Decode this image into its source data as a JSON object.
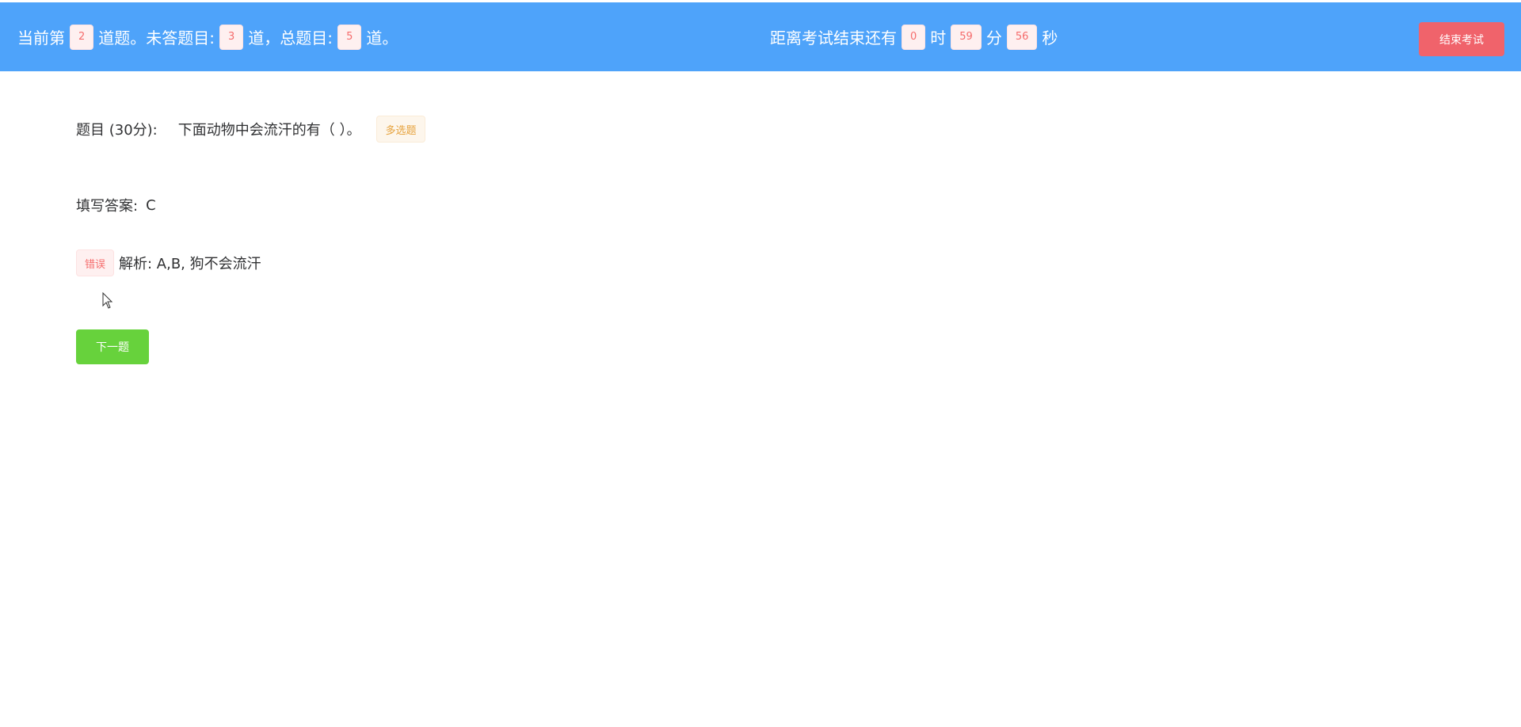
{
  "header": {
    "progress": {
      "prefix": "当前第",
      "current": "2",
      "after_current": "道题。未答题目:",
      "unanswered": "3",
      "after_unanswered": "道，总题目:",
      "total": "5",
      "suffix": "道。"
    },
    "timer": {
      "prefix": "距离考试结束还有",
      "hours": "0",
      "hours_unit": "时",
      "minutes": "59",
      "minutes_unit": "分",
      "seconds": "56",
      "seconds_unit": "秒"
    },
    "end_button_label": "结束考试"
  },
  "question": {
    "label": "题目 (30分):",
    "text": "下面动物中会流汗的有（ ）。",
    "type_tag": "多选题"
  },
  "answer": {
    "label": "填写答案:",
    "value": "C"
  },
  "analysis": {
    "result_tag": "错误",
    "text": "解析: A,B, 狗不会流汗"
  },
  "next_button_label": "下一题",
  "colors": {
    "header_bg": "#4ea3fa",
    "end_button_bg": "#f0636b",
    "next_button_bg": "#67d23c",
    "danger_text": "#f56c6c",
    "warning_text": "#e6a23c"
  }
}
